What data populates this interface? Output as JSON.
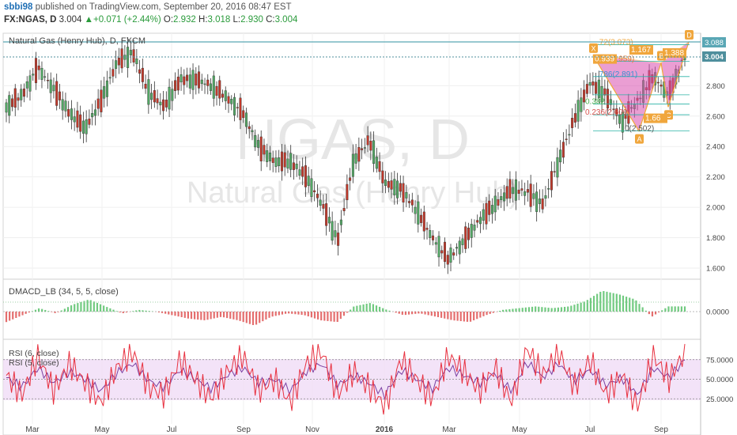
{
  "header": {
    "author": "sbbi98",
    "published_text": "published on TradingView.com, September 20, 2016 08:47 EST",
    "symbol": "FX:NGAS, D",
    "last": "3.004",
    "change": "+0.071 (+2.44%)",
    "open_label": "O:",
    "open": "2.932",
    "high_label": "H:",
    "high": "3.018",
    "low_label": "L:",
    "low": "2.930",
    "close_label": "C:",
    "close": "3.004"
  },
  "colors": {
    "up_candle": "#53a865",
    "down_candle": "#c0392b",
    "wick": "#333333",
    "pattern_fill": "#d94fb0",
    "pattern_line": "#f0a63c",
    "fib_line": "#2bb3a6",
    "macd_pos": "#59c16a",
    "macd_neg": "#e05555",
    "rsi_line": "#e8303f",
    "rsi2_line": "#7b3fa1",
    "rsi_band": "#efd9f5",
    "price_badge_high": "#5aa7b5",
    "price_badge_last": "#4f8f9d"
  },
  "chart_data": [
    {
      "type": "candlestick",
      "title": "Natural Gas (Henry Hub), D, FXCM",
      "watermark_symbol": "NGAS, D",
      "watermark_name": "Natural Gas (Henry Hub)",
      "x_ticks": [
        "Mar",
        "May",
        "Jul",
        "Sep",
        "Nov",
        "2016",
        "Mar",
        "May",
        "Jul",
        "Sep"
      ],
      "y_ticks": [
        "1.600",
        "1.800",
        "2.000",
        "2.200",
        "2.400",
        "2.600",
        "2.800",
        "3.004",
        "3.088"
      ],
      "ylim": [
        1.55,
        3.1
      ],
      "price_line_high": 3.088,
      "price_line_last": 3.004,
      "close_path": [
        {
          "x": "Feb 2015",
          "y": 2.66
        },
        {
          "x": "early Mar 2015",
          "y": 2.74
        },
        {
          "x": "mid Mar 2015",
          "y": 2.92
        },
        {
          "x": "late Mar 2015",
          "y": 2.78
        },
        {
          "x": "Apr 2015",
          "y": 2.62
        },
        {
          "x": "mid Apr 2015",
          "y": 2.52
        },
        {
          "x": "late Apr 2015",
          "y": 2.7
        },
        {
          "x": "mid May 2015",
          "y": 2.95
        },
        {
          "x": "late May 2015",
          "y": 3.02
        },
        {
          "x": "Jun 2015",
          "y": 2.76
        },
        {
          "x": "mid Jun 2015",
          "y": 2.66
        },
        {
          "x": "Jul 2015",
          "y": 2.84
        },
        {
          "x": "mid Jul 2015",
          "y": 2.84
        },
        {
          "x": "Aug 2015",
          "y": 2.8
        },
        {
          "x": "Sep 2015",
          "y": 2.72
        },
        {
          "x": "late Sep 2015",
          "y": 2.62
        },
        {
          "x": "Oct 2015",
          "y": 2.4
        },
        {
          "x": "mid Oct 2015",
          "y": 2.3
        },
        {
          "x": "Nov 2015",
          "y": 2.3
        },
        {
          "x": "mid Nov 2015",
          "y": 2.2
        },
        {
          "x": "late Nov 2015",
          "y": 2.02
        },
        {
          "x": "Dec 2015",
          "y": 1.78
        },
        {
          "x": "late Dec 2015",
          "y": 2.3
        },
        {
          "x": "Jan 2016",
          "y": 2.44
        },
        {
          "x": "mid Jan 2016",
          "y": 2.16
        },
        {
          "x": "Feb 2016",
          "y": 2.12
        },
        {
          "x": "mid Feb 2016",
          "y": 1.98
        },
        {
          "x": "late Feb 2016",
          "y": 1.8
        },
        {
          "x": "early Mar 2016",
          "y": 1.66
        },
        {
          "x": "mid Mar 2016",
          "y": 1.78
        },
        {
          "x": "Apr 2016",
          "y": 1.92
        },
        {
          "x": "mid Apr 2016",
          "y": 2.02
        },
        {
          "x": "May 2016",
          "y": 2.12
        },
        {
          "x": "mid May 2016",
          "y": 2.1
        },
        {
          "x": "late May 2016",
          "y": 2.02
        },
        {
          "x": "Jun 2016",
          "y": 2.3
        },
        {
          "x": "mid Jun 2016",
          "y": 2.58
        },
        {
          "x": "Jul 2016",
          "y": 2.82
        },
        {
          "x": "mid Jul 2016",
          "y": 2.74
        },
        {
          "x": "Aug 2016",
          "y": 2.56
        },
        {
          "x": "mid Aug 2016",
          "y": 2.7
        },
        {
          "x": "late Aug 2016",
          "y": 2.86
        },
        {
          "x": "Sep 2016",
          "y": 2.74
        },
        {
          "x": "Sep 20 2016",
          "y": 3.004
        }
      ],
      "harmonic_points": [
        {
          "label": "X",
          "y": 3.0
        },
        {
          "label": "A",
          "y": 2.502
        },
        {
          "label": "B",
          "y": 2.95
        },
        {
          "label": "C",
          "y": 2.66
        },
        {
          "label": "D",
          "y": 3.088
        }
      ],
      "annotations": [
        {
          "text": "0(2.502)",
          "y": 2.502,
          "color": "#555555"
        },
        {
          "text": "0.236(2.609)",
          "y": 2.609,
          "color": "#d9534f"
        },
        {
          "text": "0.382",
          "y": 2.68,
          "color": "#4caf50"
        },
        {
          "text": ".786(2.891)",
          "y": 2.86,
          "color": "#3a8fd0"
        },
        {
          "text": "1(2.959)",
          "y": 2.96,
          "color": "#e07b39"
        },
        {
          "text": ".72(3.073)",
          "y": 3.07,
          "color": "#f0a63c"
        },
        {
          "text": "1.167",
          "y": 3.02,
          "color": "#ffffff"
        },
        {
          "text": "0.939",
          "y": 2.96,
          "color": "#ffffff"
        },
        {
          "text": "1.388",
          "y": 3.0,
          "color": "#ffffff"
        },
        {
          "text": "1.66",
          "y": 2.57,
          "color": "#ffffff"
        }
      ]
    },
    {
      "type": "bar",
      "title": "DMACD_LB (34, 5, 5, close)",
      "y_ticks": [
        "0.0000"
      ],
      "series": [
        {
          "values": [
            -0.06,
            -0.02,
            0.02,
            -0.01,
            0.04,
            0.07,
            0.03,
            -0.01,
            0.01,
            0.0,
            -0.02,
            -0.04,
            -0.05,
            -0.03,
            -0.05,
            -0.08,
            -0.03,
            -0.01,
            -0.02,
            -0.05,
            -0.06,
            0.03,
            0.05,
            0.01,
            -0.02,
            -0.01,
            -0.03,
            -0.05,
            -0.06,
            -0.02,
            0.01,
            0.02,
            0.03,
            0.02,
            0.03,
            0.06,
            0.12,
            0.1,
            0.07,
            -0.03,
            0.03,
            0.03
          ]
        }
      ]
    },
    {
      "type": "line",
      "title": "RSI (6, close)",
      "subtitle": "RSI (5, close)",
      "y_ticks": [
        "25.0000",
        "50.0000",
        "75.0000"
      ],
      "ylim": [
        0,
        100
      ],
      "series": [
        {
          "name": "RSI (6, close)",
          "values": [
            55,
            30,
            80,
            35,
            70,
            45,
            20,
            65,
            85,
            40,
            30,
            75,
            50,
            25,
            60,
            80,
            35,
            50,
            20,
            70,
            85,
            30,
            60,
            40,
            15,
            75,
            50,
            25,
            80,
            60,
            35,
            65,
            20,
            90,
            55,
            85,
            40,
            75,
            30,
            55,
            15,
            80,
            50,
            85
          ]
        },
        {
          "name": "RSI (5, close)",
          "values": [
            52,
            40,
            65,
            45,
            60,
            50,
            35,
            58,
            70,
            48,
            40,
            62,
            50,
            38,
            55,
            65,
            45,
            50,
            35,
            60,
            70,
            42,
            55,
            45,
            30,
            62,
            50,
            38,
            65,
            55,
            45,
            58,
            35,
            72,
            52,
            70,
            48,
            62,
            42,
            52,
            30,
            65,
            52,
            75
          ]
        }
      ]
    }
  ]
}
